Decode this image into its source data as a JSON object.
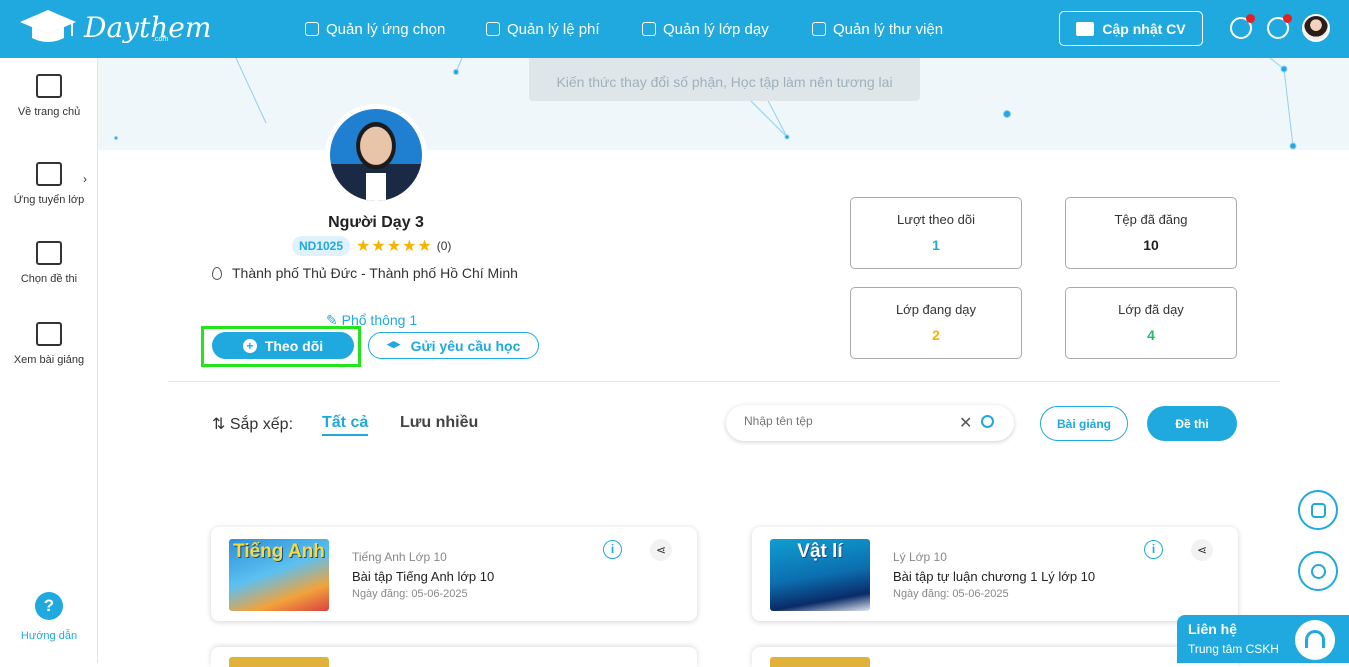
{
  "header": {
    "logo_text": "Daythem",
    "logo_sub": ".com",
    "nav": [
      {
        "label": "Quản lý ứng chọn"
      },
      {
        "label": "Quản lý lệ phí"
      },
      {
        "label": "Quản lý lớp dạy"
      },
      {
        "label": "Quản lý thư viện"
      }
    ],
    "cv_button": "Cập nhật CV"
  },
  "sidebar": {
    "items": [
      {
        "label": "Về trang chủ"
      },
      {
        "label": "Ứng tuyển lớp"
      },
      {
        "label": "Chọn đề thi"
      },
      {
        "label": "Xem bài giảng"
      }
    ],
    "arrow": "›",
    "help_icon": "?",
    "help_label": "Hướng dẫn"
  },
  "banner": {
    "slogan": "Kiến thức thay đổi số phận, Học tập làm nên tương lai"
  },
  "profile": {
    "name": "Người Dạy 3",
    "code": "ND1025",
    "stars": "★★★★★",
    "rating_count": "(0)",
    "location": "Thành phố Thủ Đức - Thành phố Hồ Chí Minh",
    "subject": "Phổ thông 1",
    "follow_label": "Theo dõi",
    "follow_icon": "+",
    "request_label": "Gửi yêu cầu học"
  },
  "stats": [
    {
      "label": "Lượt theo dõi",
      "value": "1",
      "color": "#1fa9df"
    },
    {
      "label": "Tệp đã đăng",
      "value": "10",
      "color": "#222222"
    },
    {
      "label": "Lớp đang dạy",
      "value": "2",
      "color": "#f5b400"
    },
    {
      "label": "Lớp đã dạy",
      "value": "4",
      "color": "#2db56b"
    }
  ],
  "filter": {
    "sort_label": "⇅ Sắp xếp:",
    "tab_all": "Tất cả",
    "tab_saved": "Lưu nhiều",
    "search_placeholder": "Nhập tên tệp",
    "clear_icon": "✕",
    "btn_lecture": "Bài giảng",
    "btn_exam": "Đề thi"
  },
  "cards": [
    {
      "thumb": "Tiếng Anh",
      "category": "Tiếng Anh Lớp 10",
      "title": "Bài tập Tiếng Anh lớp 10",
      "date": "Ngày đăng: 05-06-2025"
    },
    {
      "thumb": "Vật lí",
      "category": "Lý Lớp 10",
      "title": "Bài tập tự luận chương 1 Lý lớp 10",
      "date": "Ngày đăng: 05-06-2025"
    }
  ],
  "card_icons": {
    "info": "i",
    "share": "⋖"
  },
  "contact": {
    "title": "Liên hệ",
    "subtitle": "Trung tâm CSKH"
  },
  "colors": {
    "accent": "#1fa9df",
    "highlight": "#22e51b"
  }
}
